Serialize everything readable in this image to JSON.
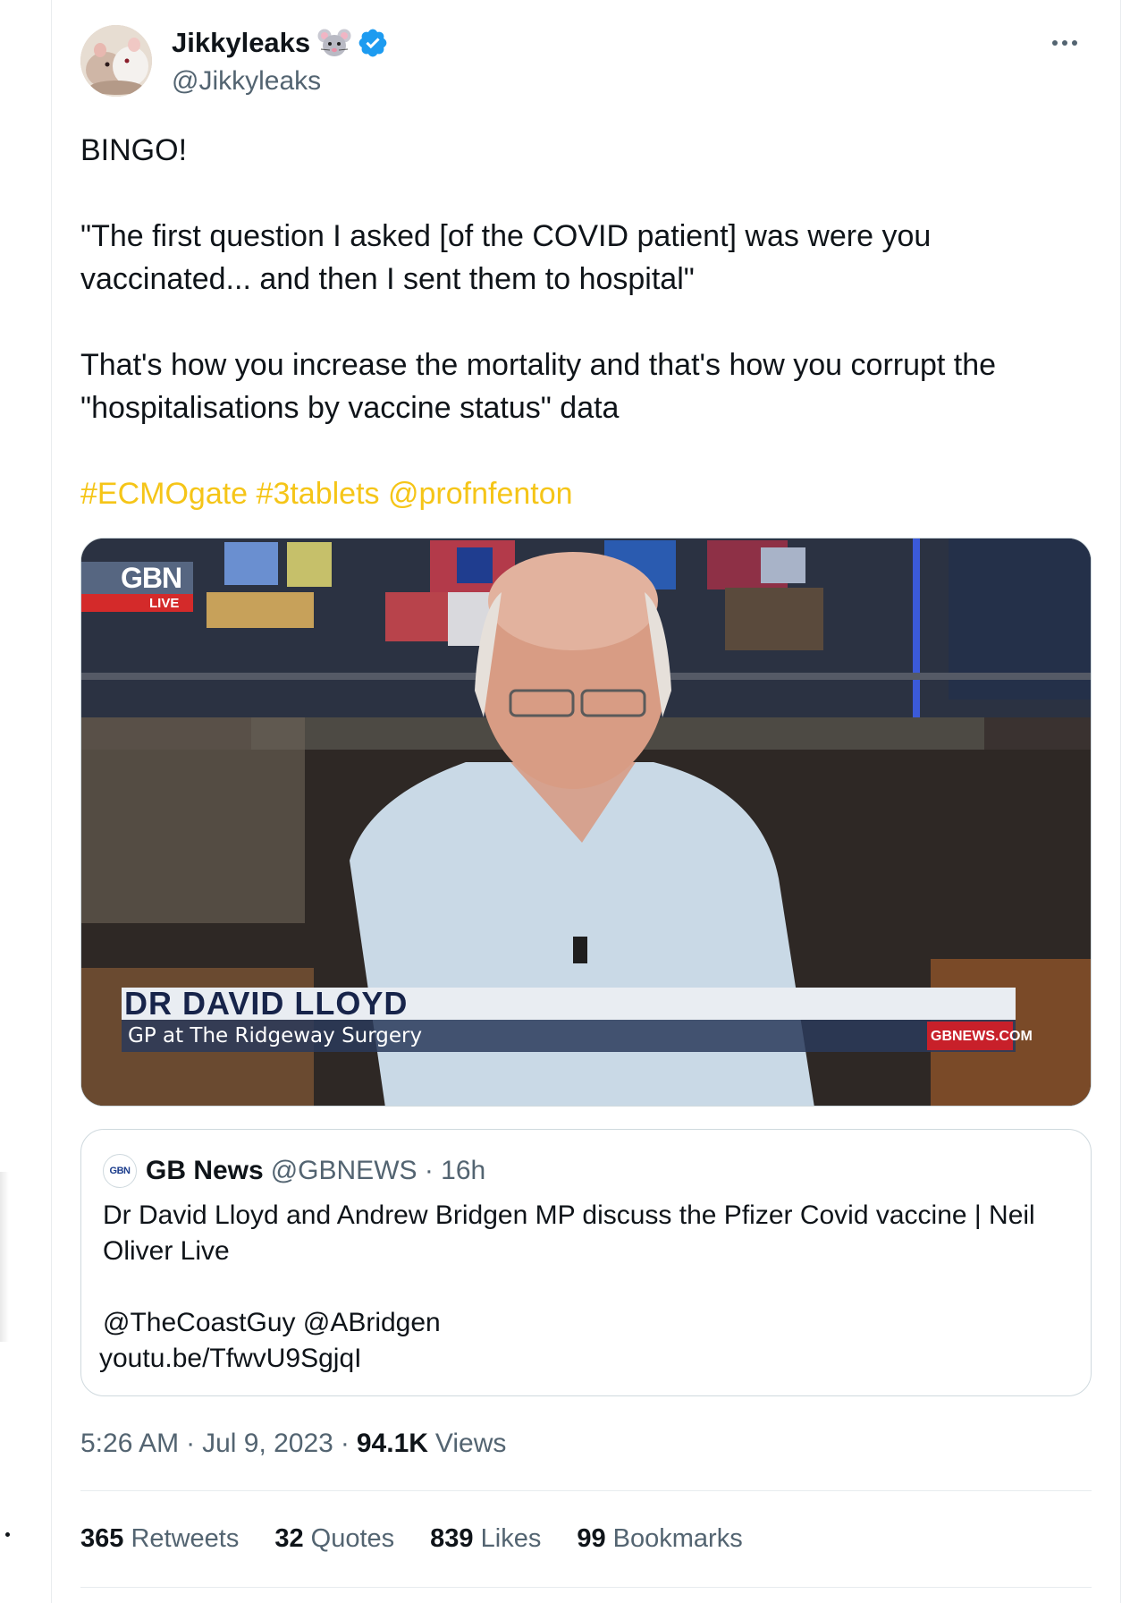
{
  "author": {
    "display_name": "Jikkyleaks",
    "handle": "@Jikkyleaks",
    "emoji_icon": "mouse-emoji",
    "verified": true
  },
  "tweet": {
    "paragraphs": [
      "BINGO!",
      "\"The first question I asked [of the COVID patient] was were you vaccinated... and then I sent them to hospital\"",
      "That's how you increase the mortality and that's how you corrupt the \"hospitalisations by vaccine status\" data"
    ],
    "tags": [
      "#ECMOgate",
      "#3tablets",
      "@profnfenton"
    ]
  },
  "media": {
    "channel_logo": "GBN",
    "live_label": "LIVE",
    "lower_third_name": "DR DAVID LLOYD",
    "lower_third_title": "GP at The Ridgeway Surgery",
    "site": "GBNEWS.COM"
  },
  "quote": {
    "avatar_text": "GBN",
    "name": "GB News",
    "meta": "@GBNEWS · 16h",
    "text": "Dr David Lloyd and Andrew Bridgen MP discuss the Pfizer Covid vaccine | Neil Oliver Live",
    "mentions": "@TheCoastGuy @ABridgen",
    "link": "youtu.be/TfwvU9SgjqI"
  },
  "meta": {
    "time": "5:26 AM",
    "date": "Jul 9, 2023",
    "views_count": "94.1K",
    "views_label": "Views"
  },
  "stats": [
    {
      "count": "365",
      "label": "Retweets"
    },
    {
      "count": "32",
      "label": "Quotes"
    },
    {
      "count": "839",
      "label": "Likes"
    },
    {
      "count": "99",
      "label": "Bookmarks"
    }
  ],
  "colors": {
    "hashtag": "#f5c518",
    "secondary_text": "#536471",
    "verified_blue": "#1d9bf0",
    "border": "#cfd9de"
  }
}
